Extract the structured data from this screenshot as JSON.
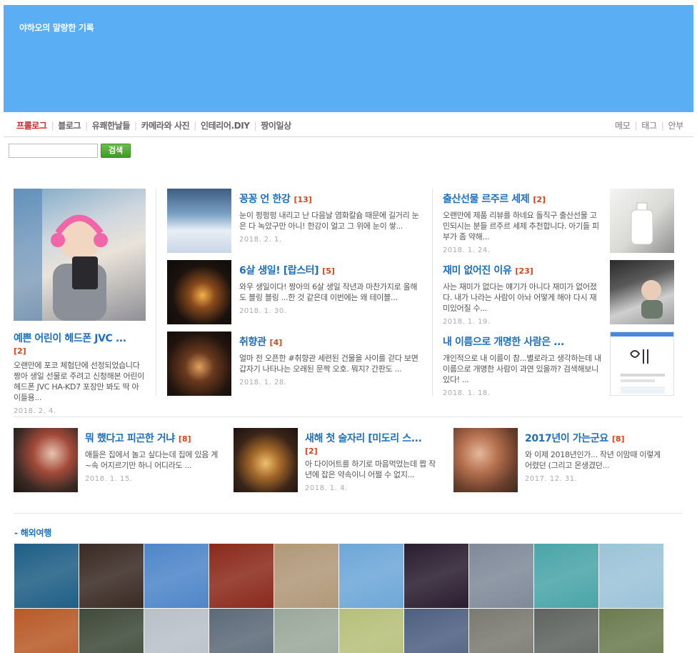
{
  "site": {
    "title": "야하오의 말랑한 기록"
  },
  "nav": {
    "left": [
      "프롤로그",
      "블로그",
      "유쾌한날들",
      "카메라와 사진",
      "인테리어.DIY",
      "짱이일상"
    ],
    "right": [
      "메모",
      "태그",
      "안부"
    ]
  },
  "search": {
    "button": "검색",
    "value": ""
  },
  "featured": {
    "title": "예쁜 어린이 헤드폰 JVC ...",
    "comments": "[2]",
    "excerpt": "오랜만에 포코 체험단에 선정되었습니다 짱아 생일 선물로 주려고 신청해본 어린이 헤드폰 JVC HA-KD7 포장만 봐도 딱 아이들용...",
    "date": "2018. 2. 4."
  },
  "middle": [
    {
      "title": "꽁꽁 언 한강",
      "comments": "[13]",
      "excerpt": "눈이 펑펑펑 내리고 난 다음날 염화칼슘 때문에 길거리 눈은 다 녹았구만 아니! 한강이 얼고 그 위에 눈이 쌓...",
      "date": "2018. 2. 1."
    },
    {
      "title": "6살 생일! [랍스터]",
      "comments": "[5]",
      "excerpt": "와우 생일이다! 짱아의 6살 생일 작년과 마찬가지로 올해도 블링 블링 ...한 것 같은데 이번에는 왜 테이블...",
      "date": "2018. 1. 30."
    },
    {
      "title": "취향관",
      "comments": "[4]",
      "excerpt": "얼마 전 오픈한 #취향관 세련된 건물을 사이를 걷다 보면 갑자기 나타나는 오래된 문짝 오호. 뭐지? 간판도 ...",
      "date": "2018. 1. 28."
    }
  ],
  "right": [
    {
      "title": "출산선물 르주르 세제",
      "comments": "[2]",
      "excerpt": "오랜만에 제품 리뷰를 하네요 돌직구 출산선물 고민되시는 분들 르주르 세제 추천합니다. 아기들 피부가 좀 약해...",
      "date": "2018. 1. 24."
    },
    {
      "title": "재미 없어진 이유",
      "comments": "[23]",
      "excerpt": "사는 재미가 없다는 얘기가 아니다 재미가 없어졌다. 내가 나라는 사람이 아놔 어떻게 해야 다시 재미있어질 수...",
      "date": "2018. 1. 19."
    },
    {
      "title": "내 이름으로 개명한 사람은 ...",
      "comments": "",
      "excerpt": "개인적으로 내 이름이 참...별로라고 생각하는데 내 이름으로 개명한 사람이 과연 있을까? 검색해보니 있다! ...",
      "date": "2018. 1. 18."
    }
  ],
  "row2": [
    {
      "title": "뭐 했다고 피곤한 거냐",
      "comments": "[8]",
      "excerpt": "애들은 집에서 놀고 싶다는데 집에 있음 계~속 어지르기만 하니 어디라도 ...",
      "date": "2018. 1. 15."
    },
    {
      "title": "새해 첫 술자리 [미도리 스...",
      "comments": "[2]",
      "excerpt": "아 다이어트를 하기로 마음먹었는데 짭 작년에 잡은 약속이니 어쩔 수 없지...",
      "date": "2018. 1. 4."
    },
    {
      "title": "2017년이 가는군요",
      "comments": "[8]",
      "excerpt": "와 이제 2018년인가... 작년 이맘때 이렇게 어렸던 (그리고 몬생겼던...",
      "date": "2017. 12. 31."
    }
  ],
  "section": {
    "title": "- 해외여행"
  },
  "gallery_colors": [
    [
      "#1f5f86",
      "#3a2a24",
      "#4f86c9",
      "#8b2a1c",
      "#b19879",
      "#6ea7d8",
      "#2a1d30",
      "#7f8a99",
      "#4aa5a8",
      "#9cc3d8"
    ],
    [
      "#b85a28",
      "#3e4a3a",
      "#b8c0c8",
      "#5c6a78",
      "#9aa89a",
      "#b6c07a",
      "#4e5f80",
      "#7a7a72",
      "#5f6460",
      "#6b7b4e"
    ]
  ]
}
